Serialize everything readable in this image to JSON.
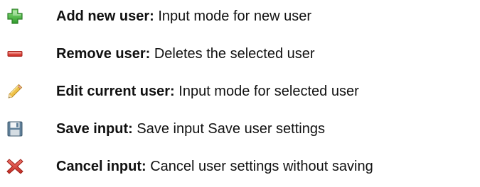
{
  "legend": {
    "items": [
      {
        "icon": "add-user-icon",
        "term": "Add new user:",
        "description": "Input mode for new user"
      },
      {
        "icon": "remove-user-icon",
        "term": "Remove user:",
        "description": "Deletes the selected user"
      },
      {
        "icon": "edit-pencil-icon",
        "term": "Edit current user:",
        "description": "Input mode for selected user"
      },
      {
        "icon": "save-floppy-icon",
        "term": "Save input:",
        "description": "Save input Save user settings"
      },
      {
        "icon": "cancel-x-icon",
        "term": "Cancel input:",
        "description": "Cancel user settings without saving"
      }
    ]
  },
  "colors": {
    "add_green": "#4caf3a",
    "remove_red": "#d9342b",
    "pencil_yellow": "#e7b93b",
    "floppy_blue": "#5f7f99",
    "cancel_red": "#d7372f"
  }
}
